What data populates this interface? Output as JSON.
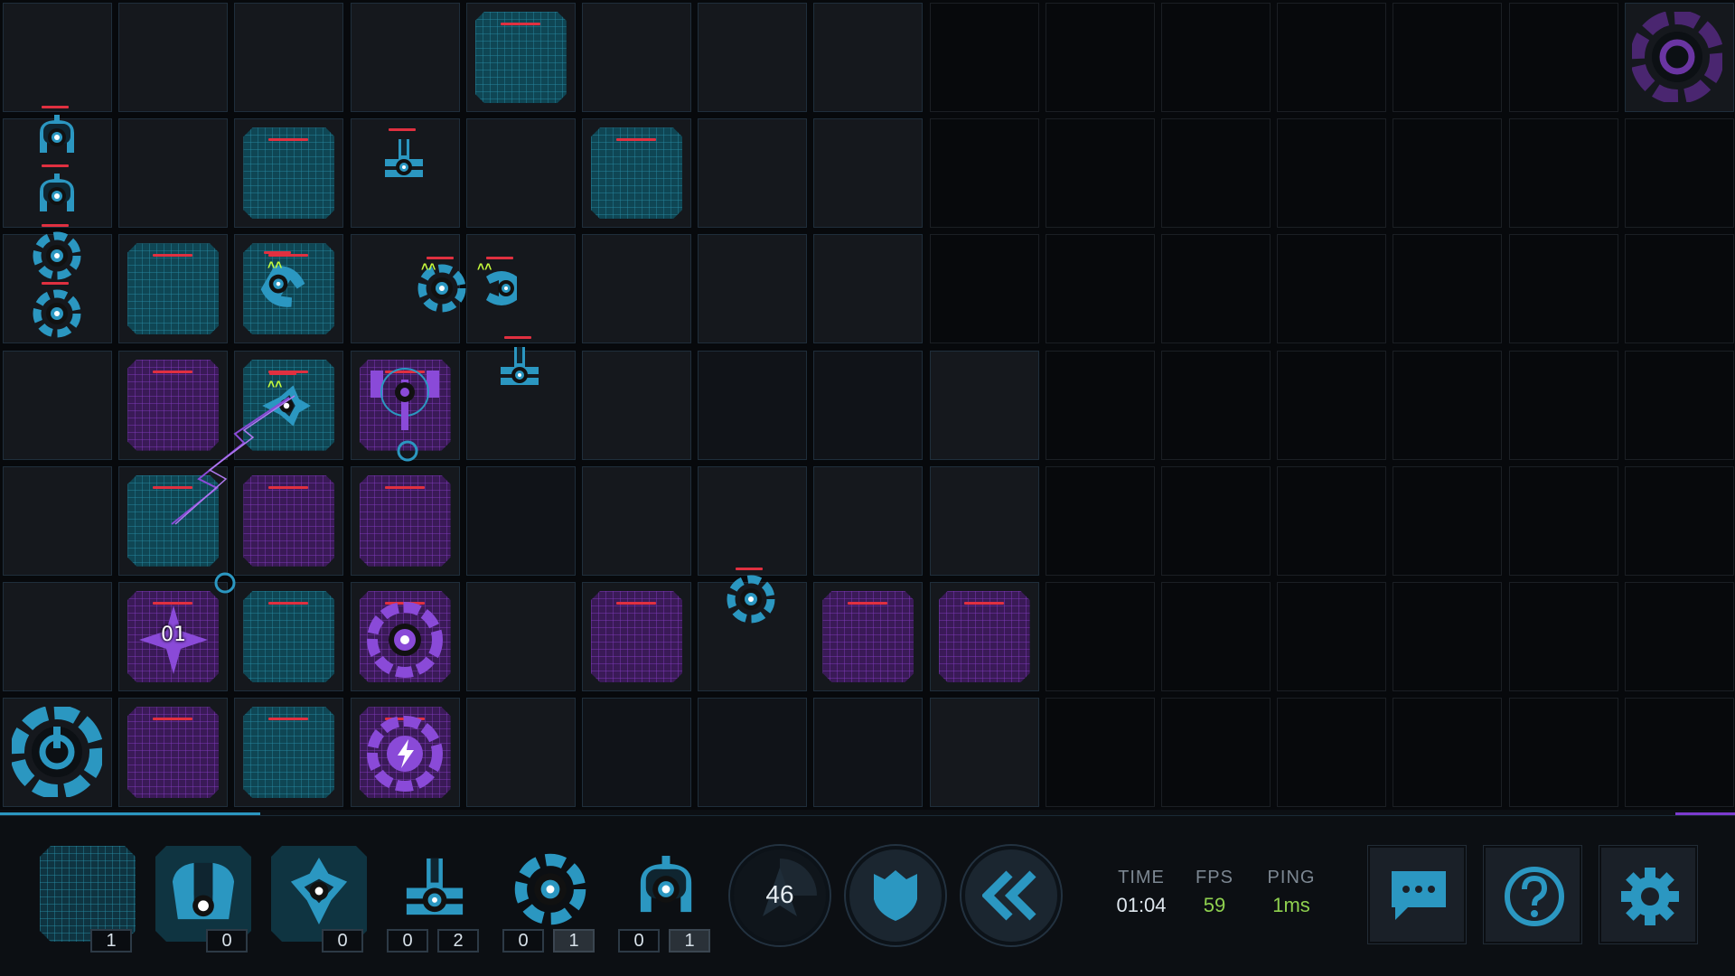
{
  "stats": {
    "time_label": "TIME",
    "time_value": "01:04",
    "fps_label": "FPS",
    "fps_value": "59",
    "ping_label": "PING",
    "ping_value": "1ms"
  },
  "colors": {
    "player": "#2b97c1",
    "enemy": "#7d3bd0",
    "hp_bar": "#e03040",
    "upgrade": "#c8ff3c",
    "fps": "#8fd14f",
    "ping": "#8fd14f"
  },
  "resource_counter": "46",
  "overlay_timer": "01",
  "hotbar": [
    {
      "icon": "tile-icon",
      "counts": [
        "1"
      ]
    },
    {
      "icon": "cannon-unit-icon",
      "counts": [
        "0"
      ]
    },
    {
      "icon": "arrow-unit-icon",
      "counts": [
        "0"
      ]
    },
    {
      "icon": "turret-unit-icon",
      "counts": [
        "0",
        "2"
      ]
    },
    {
      "icon": "spinner-unit-icon",
      "counts": [
        "0",
        "1"
      ]
    },
    {
      "icon": "dome-unit-icon",
      "counts": [
        "0",
        "1"
      ]
    }
  ],
  "actions": [
    {
      "name": "stats-button",
      "icon": "triangle-emblem-icon"
    },
    {
      "name": "shield-button",
      "icon": "shield-icon"
    },
    {
      "name": "rewind-button",
      "icon": "double-chevron-left-icon"
    }
  ],
  "menu_buttons": [
    {
      "name": "chat-button",
      "icon": "chat-icon"
    },
    {
      "name": "help-button",
      "icon": "help-icon"
    },
    {
      "name": "settings-button",
      "icon": "gear-icon"
    }
  ]
}
